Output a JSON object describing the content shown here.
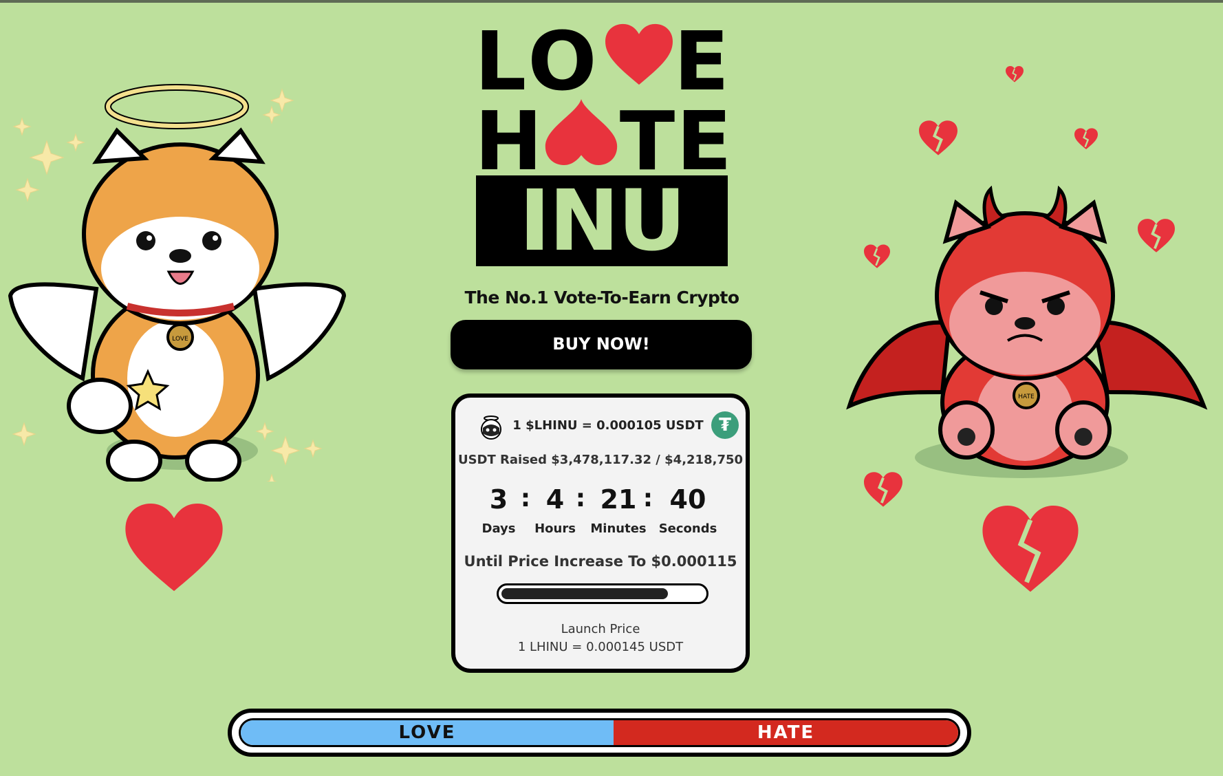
{
  "logo": {
    "line1": [
      "L",
      "O",
      "E"
    ],
    "line2": [
      "H",
      "T",
      "E"
    ],
    "line3": "INU"
  },
  "tagline": "The No.1 Vote-To-Earn Crypto",
  "buy_button": "BUY NOW!",
  "presale": {
    "rate": "1 $LHINU = 0.000105 USDT",
    "tether_symbol": "₮",
    "raised": "USDT Raised $3,478,117.32 / $4,218,750",
    "raised_fraction": 0.8244,
    "countdown": {
      "days": "3",
      "hours": "4",
      "minutes": "21",
      "seconds": "40",
      "days_label": "Days",
      "hours_label": "Hours",
      "minutes_label": "Minutes",
      "seconds_label": "Seconds",
      "separator": ":"
    },
    "until_text": "Until Price Increase To $0.000115",
    "launch_title": "Launch Price",
    "launch_price": "1 LHINU = 0.000145 USDT"
  },
  "vote_bar": {
    "love_label": "LOVE",
    "hate_label": "HATE",
    "love_fraction": 0.52
  },
  "badges": {
    "love": "LOVE",
    "hate": "HATE"
  },
  "colors": {
    "background": "#bde09c",
    "heart": "#e8333d",
    "love_blue": "#6fbcf6",
    "hate_red": "#d3291f"
  }
}
